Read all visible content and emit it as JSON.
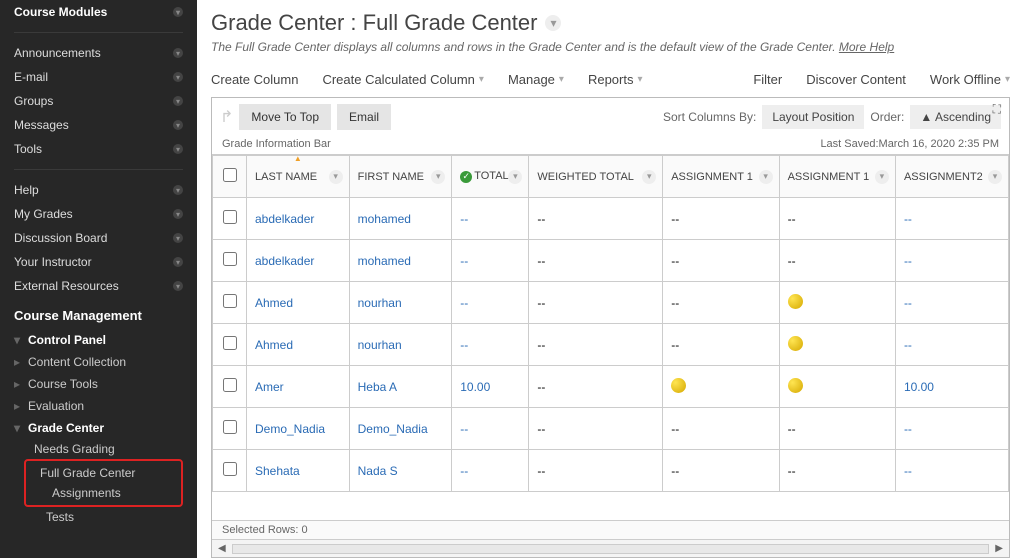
{
  "sidebar_groups": {
    "g1": [
      "Course Modules"
    ],
    "g2": [
      "Announcements",
      "E-mail",
      "Groups",
      "Messages",
      "Tools"
    ],
    "g3": [
      "Help",
      "My Grades",
      "Discussion Board",
      "Your Instructor",
      "External Resources"
    ]
  },
  "management_heading": "Course Management",
  "control_panel": {
    "heading": "Control Panel",
    "items": [
      "Content Collection",
      "Course Tools",
      "Evaluation"
    ],
    "grade_center": {
      "label": "Grade Center",
      "children": [
        "Needs Grading",
        "Full Grade Center",
        "Assignments",
        "Tests"
      ]
    }
  },
  "page": {
    "title": "Grade Center : Full Grade Center",
    "subtitle_prefix": "The Full Grade Center displays all columns and rows in the Grade Center and is the default view of the Grade Center. ",
    "more_help": "More Help"
  },
  "toolbar": {
    "create_column": "Create Column",
    "create_calculated": "Create Calculated Column",
    "manage": "Manage",
    "reports": "Reports",
    "filter": "Filter",
    "discover": "Discover Content",
    "work_offline": "Work Offline"
  },
  "panel_top": {
    "move_to_top": "Move To Top",
    "email": "Email",
    "sort_label": "Sort Columns By:",
    "layout_position": "Layout Position",
    "order_label": "Order:",
    "ascending": "Ascending"
  },
  "gib": {
    "label": "Grade Information Bar",
    "last_saved": "Last Saved:March 16, 2020 2:35 PM"
  },
  "columns": [
    "LAST NAME",
    "FIRST NAME",
    "TOTAL",
    "WEIGHTED TOTAL",
    "ASSIGNMENT 1",
    "ASSIGNMENT 1",
    "ASSIGNMENT2"
  ],
  "rows": [
    {
      "last": "abdelkader",
      "first": "mohamed",
      "total": "--",
      "wt": "--",
      "a1": "--",
      "a2": "--",
      "a3": "--"
    },
    {
      "last": "abdelkader",
      "first": "mohamed",
      "total": "--",
      "wt": "--",
      "a1": "--",
      "a2": "--",
      "a3": "--"
    },
    {
      "last": "Ahmed",
      "first": "nourhan",
      "total": "--",
      "wt": "--",
      "a1": "--",
      "a2": "●",
      "a3": "--"
    },
    {
      "last": "Ahmed",
      "first": "nourhan",
      "total": "--",
      "wt": "--",
      "a1": "--",
      "a2": "●",
      "a3": "--"
    },
    {
      "last": "Amer",
      "first": "Heba A",
      "total": "10.00",
      "wt": "--",
      "a1": "●",
      "a2": "●",
      "a3": "10.00"
    },
    {
      "last": "Demo_Nadia",
      "first": "Demo_Nadia",
      "total": "--",
      "wt": "--",
      "a1": "--",
      "a2": "--",
      "a3": "--"
    },
    {
      "last": "Shehata",
      "first": "Nada S",
      "total": "--",
      "wt": "--",
      "a1": "--",
      "a2": "--",
      "a3": "--"
    }
  ],
  "selected_rows": "Selected Rows: 0"
}
